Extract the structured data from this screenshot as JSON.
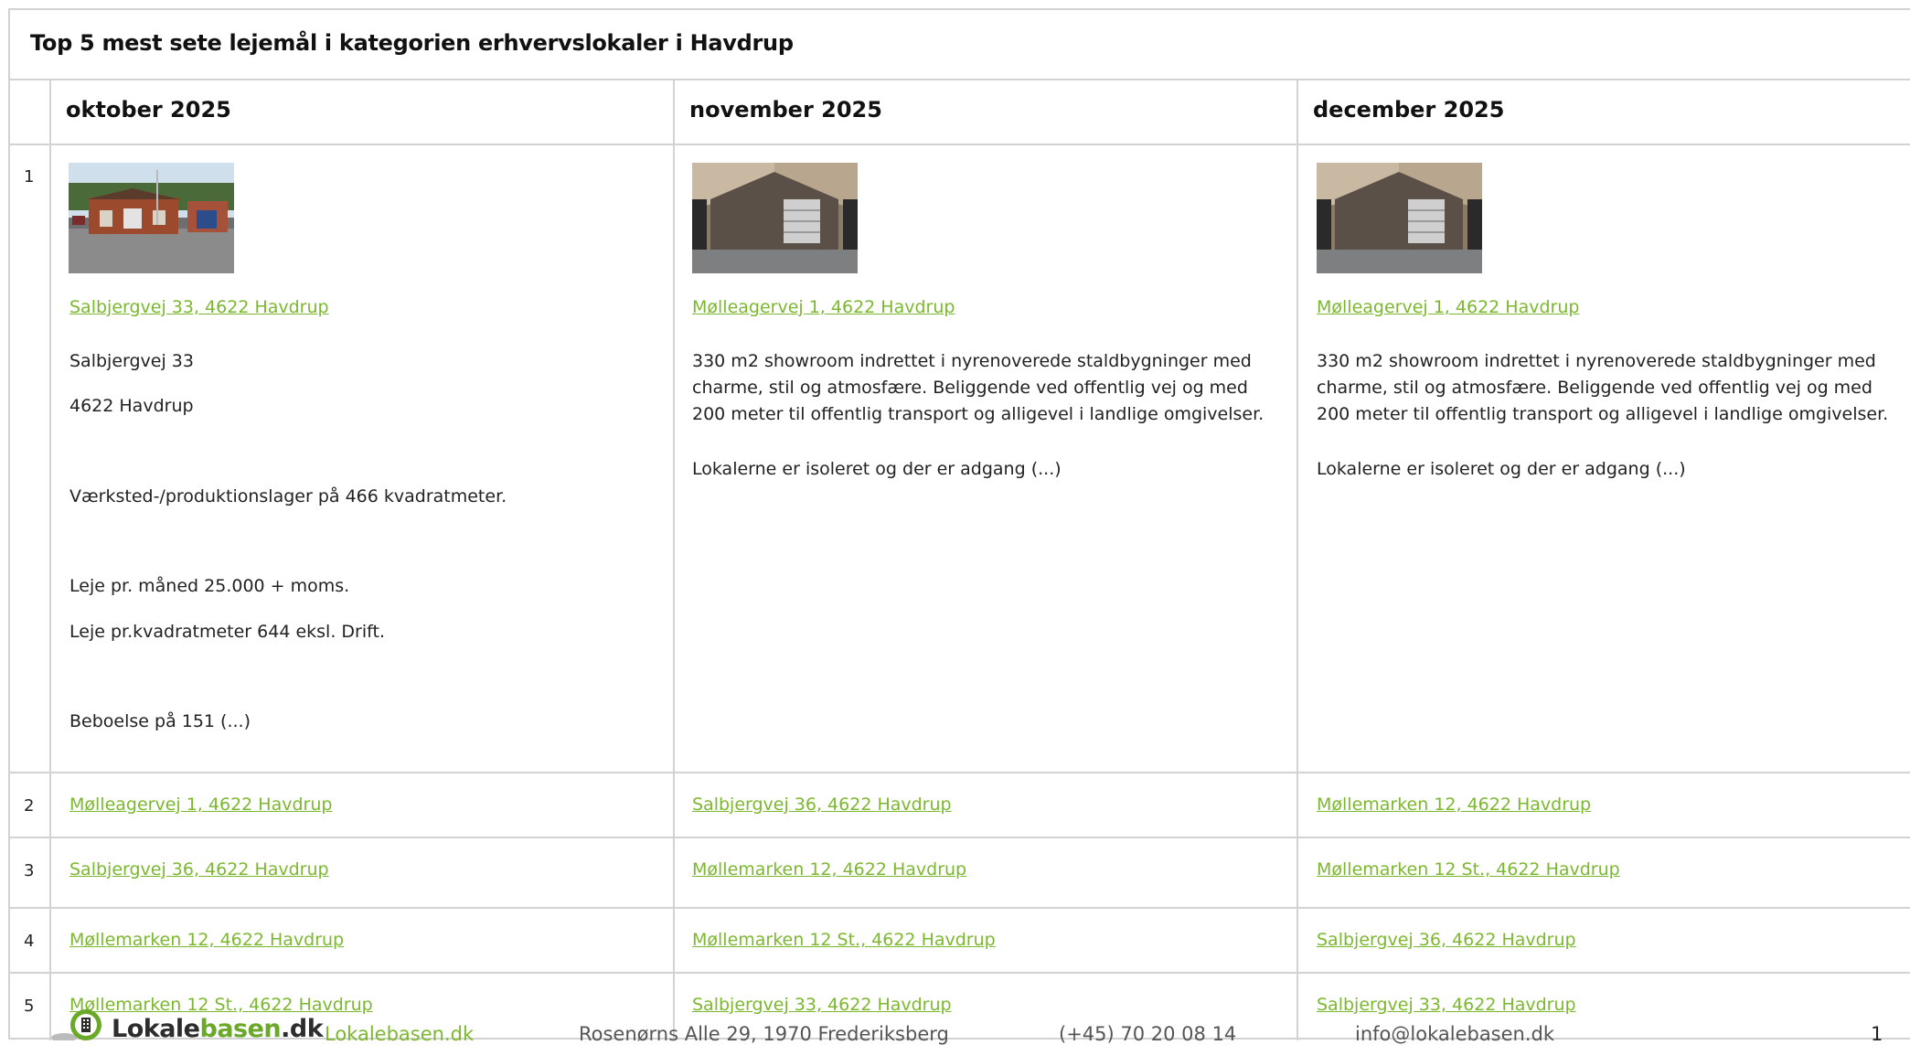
{
  "table": {
    "title": "Top 5 mest sete lejemål i kategorien erhvervslokaler i Havdrup",
    "columns": [
      "oktober 2025",
      "november 2025",
      "december 2025"
    ],
    "ranks": [
      "1",
      "2",
      "3",
      "4",
      "5"
    ],
    "top": {
      "october": {
        "image": "industrial-building-photo",
        "link": "Salbjergvej 33, 4622 Havdrup",
        "lines": [
          "Salbjergvej 33",
          "4622 Havdrup",
          "Værksted-/produktionslager på 466 kvadratmeter.",
          "Leje pr. måned 25.000 + moms.",
          "Leje pr.kvadratmeter 644 eksl. Drift.",
          "Beboelse på 151 (...)"
        ]
      },
      "november": {
        "image": "showroom-interior-photo",
        "link": "Mølleagervej 1, 4622 Havdrup",
        "paragraph": "330 m2 showroom indrettet i nyrenoverede staldbygninger med charme, stil og atmosfære. Beliggende ved offentlig vej og med 200 meter til offentlig transport og alligevel i landlige omgivelser.",
        "paragraph2": "Lokalerne er isoleret og der er adgang (...)"
      },
      "december": {
        "image": "showroom-interior-photo",
        "link": "Mølleagervej 1, 4622 Havdrup",
        "paragraph": "330 m2 showroom indrettet i nyrenoverede staldbygninger med charme, stil og atmosfære. Beliggende ved offentlig vej og med 200 meter til offentlig transport og alligevel i landlige omgivelser.",
        "paragraph2": "Lokalerne er isoleret og der er adgang (...)"
      }
    },
    "rows": [
      [
        "Mølleagervej 1, 4622 Havdrup",
        "Salbjergvej 36, 4622 Havdrup",
        "Møllemarken 12, 4622 Havdrup"
      ],
      [
        "Salbjergvej 36, 4622 Havdrup",
        "Møllemarken 12, 4622 Havdrup",
        "Møllemarken 12 St., 4622 Havdrup"
      ],
      [
        "Møllemarken 12, 4622 Havdrup",
        "Møllemarken 12 St., 4622 Havdrup",
        "Salbjergvej 36, 4622 Havdrup"
      ],
      [
        "Møllemarken 12 St., 4622 Havdrup",
        "Salbjergvej 33, 4622 Havdrup",
        "Salbjergvej 33, 4622 Havdrup"
      ]
    ]
  },
  "footer": {
    "logo_dark": "Lokale",
    "logo_green": "basen",
    "logo_suffix": ".dk",
    "website": "Lokalebasen.dk",
    "address": "Rosenørns Alle 29, 1970 Frederiksberg",
    "phone": "(+45) 70 20 08 14",
    "email": "info@lokalebasen.dk",
    "page_number": "1"
  },
  "colors": {
    "link": "#7cb82f",
    "border": "#d2d2d2",
    "logo_green": "#6aa82a"
  }
}
